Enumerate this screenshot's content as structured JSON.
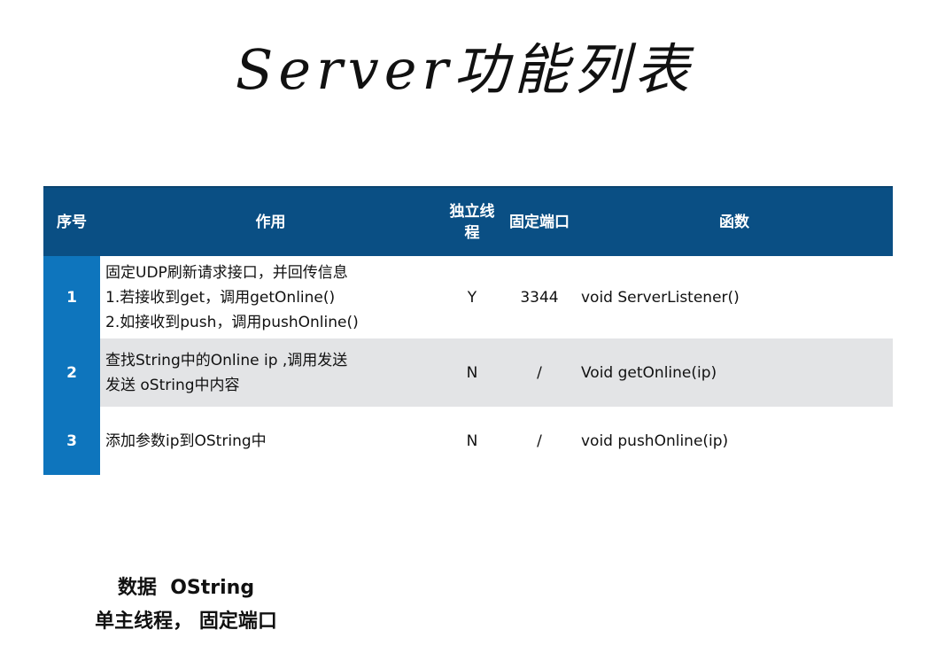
{
  "title": "Server功能列表",
  "table": {
    "headers": [
      "序号",
      "作用",
      "独立线程",
      "固定端口",
      "函数"
    ],
    "rows": [
      {
        "index": "1",
        "desc_lines": [
          "固定UDP刷新请求接口，并回传信息",
          "1.若接收到get，调用getOnline()",
          "2.如接收到push，调用pushOnline()"
        ],
        "thread": "Y",
        "port": "3344",
        "func": "void ServerListener()"
      },
      {
        "index": "2",
        "desc_lines": [
          "查找String中的Online ip ,调用发送",
          "发送 oString中内容"
        ],
        "thread": "N",
        "port": "/",
        "func": "Void getOnline(ip)"
      },
      {
        "index": "3",
        "desc_lines": [
          "添加参数ip到OString中"
        ],
        "thread": "N",
        "port": "/",
        "func": "void pushOnline(ip)"
      }
    ]
  },
  "notes": [
    "数据  OString",
    "单主线程， 固定端口"
  ],
  "colors": {
    "header_bg": "#0a4f84",
    "index_bg": "#0e75bd",
    "stripe_bg": "#e3e4e6"
  }
}
